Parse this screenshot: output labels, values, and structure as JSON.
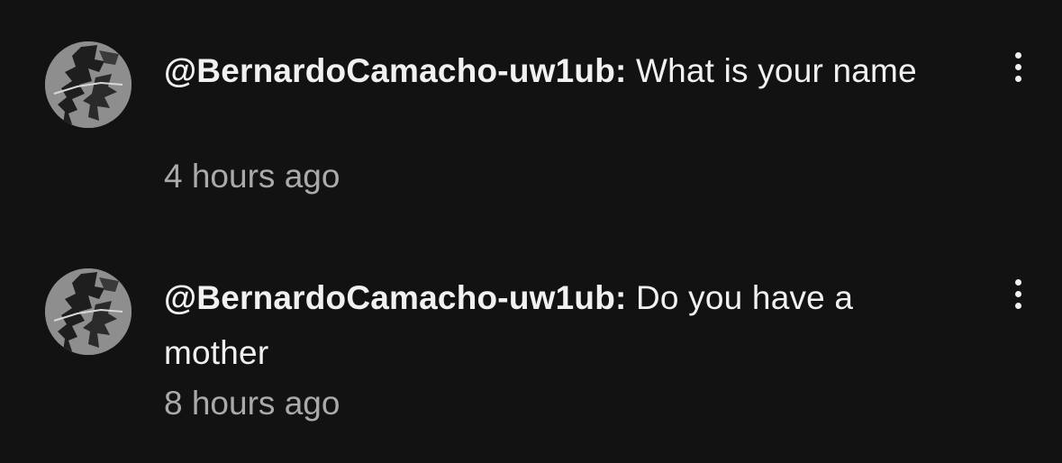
{
  "comments": [
    {
      "author": "@BernardoCamacho-uw1ub:",
      "text": "What is your name",
      "timestamp": "4 hours ago",
      "menu_icon": "more-vertical-icon"
    },
    {
      "author": "@BernardoCamacho-uw1ub:",
      "text": "Do you have a mother",
      "timestamp": "8 hours ago",
      "menu_icon": "more-vertical-icon"
    }
  ],
  "colors": {
    "background": "#121212",
    "primary_text": "#f1f1f1",
    "secondary_text": "#aaaaaa",
    "avatar_bg": "#8d8d8d"
  }
}
